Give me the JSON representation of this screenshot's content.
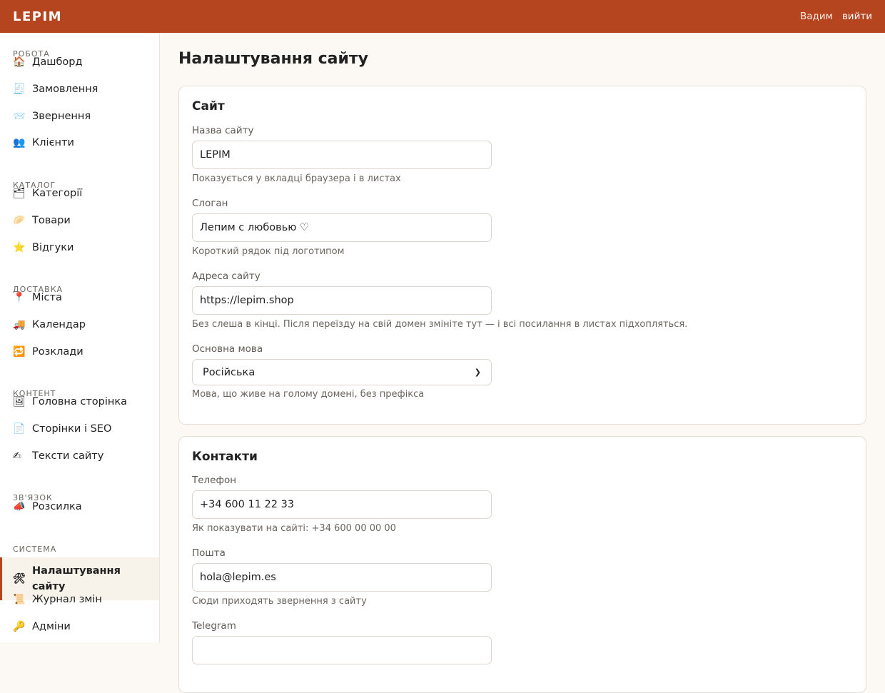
{
  "topbar": {
    "brand": "LEPIM",
    "user": "Вадим",
    "logout": "вийти"
  },
  "sidebar": {
    "sections": [
      {
        "title": "Робота",
        "items": [
          {
            "icon": "🏠",
            "icon_name": "home-icon",
            "label": "Дашборд"
          },
          {
            "icon": "🧾",
            "icon_name": "receipt-icon",
            "label": "Замовлення"
          },
          {
            "icon": "📨",
            "icon_name": "incoming-envelope-icon",
            "label": "Звернення"
          },
          {
            "icon": "👥",
            "icon_name": "users-icon",
            "label": "Клієнти"
          }
        ]
      },
      {
        "title": "Каталог",
        "items": [
          {
            "icon": "🗂",
            "icon_name": "card-index-icon",
            "label": "Категорії"
          },
          {
            "icon": "🥟",
            "icon_name": "dumpling-icon",
            "label": "Товари"
          },
          {
            "icon": "⭐",
            "icon_name": "star-icon",
            "label": "Відгуки"
          }
        ]
      },
      {
        "title": "Доставка",
        "items": [
          {
            "icon": "📍",
            "icon_name": "pin-icon",
            "label": "Міста"
          },
          {
            "icon": "🚚",
            "icon_name": "truck-icon",
            "label": "Календар"
          },
          {
            "icon": "🔁",
            "icon_name": "repeat-icon",
            "label": "Розклади"
          }
        ]
      },
      {
        "title": "Контент",
        "items": [
          {
            "icon": "🖼",
            "icon_name": "picture-icon",
            "label": "Головна сторінка"
          },
          {
            "icon": "📄",
            "icon_name": "page-icon",
            "label": "Сторінки і SEO"
          },
          {
            "icon": "✍",
            "icon_name": "writing-hand-icon",
            "label": "Тексти сайту"
          }
        ]
      },
      {
        "title": "Зв'язок",
        "items": [
          {
            "icon": "📣",
            "icon_name": "megaphone-icon",
            "label": "Розсилка"
          }
        ]
      },
      {
        "title": "Система",
        "items": [
          {
            "icon": "🛠",
            "icon_name": "tools-icon",
            "label": "Налаштування сайту",
            "active": true
          },
          {
            "icon": "📜",
            "icon_name": "scroll-icon",
            "label": "Журнал змін"
          },
          {
            "icon": "🔑",
            "icon_name": "key-icon",
            "label": "Адміни"
          }
        ]
      }
    ]
  },
  "main": {
    "title": "Налаштування сайту",
    "site": {
      "title": "Сайт",
      "name_label": "Назва сайту",
      "name_value": "LEPIM",
      "name_hint": "Показується у вкладці браузера і в листах",
      "slogan_label": "Слоган",
      "slogan_value": "Лепим с любовью ♡",
      "slogan_hint": "Короткий рядок під логотипом",
      "url_label": "Адреса сайту",
      "url_value": "https://lepim.shop",
      "url_hint": "Без слеша в кінці. Після переїзду на свій домен змініте тут — і всі посилання в листах підхопляться.",
      "lang_label": "Основна мова",
      "lang_value": "Російська",
      "lang_hint": "Мова, що живе на голому домені, без префікса"
    },
    "contacts": {
      "title": "Контакти",
      "phone_label": "Телефон",
      "phone_value": "+34 600 11 22 33",
      "phone_hint": "Як показувати на сайті: +34 600 00 00 00",
      "email_label": "Пошта",
      "email_value": "hola@lepim.es",
      "email_hint": "Сюди приходять звернення з сайту",
      "telegram_label": "Telegram"
    }
  }
}
